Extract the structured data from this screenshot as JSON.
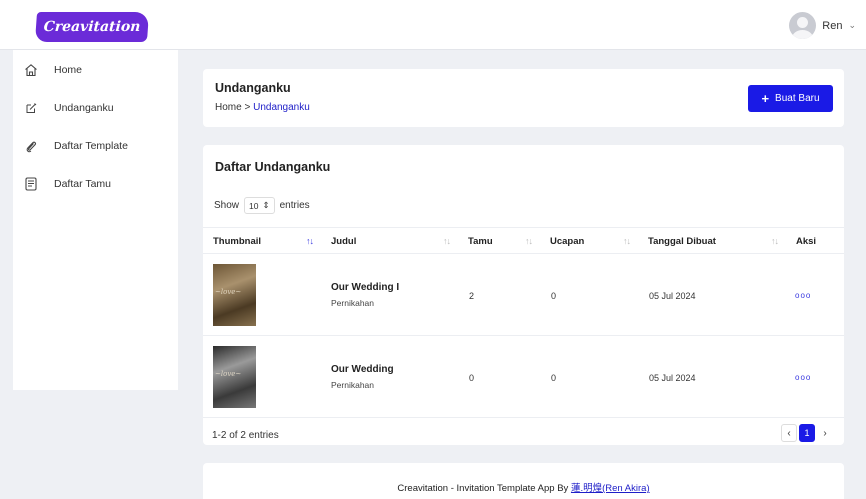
{
  "brand": {
    "logo_text": "Creavitation",
    "accent": "#6b2bd8",
    "primary": "#1a1ae6"
  },
  "user": {
    "name": "Ren",
    "dropdown_icon": "chevron-down-icon"
  },
  "sidebar": {
    "items": [
      {
        "label": "Home",
        "icon": "home-icon"
      },
      {
        "label": "Undanganku",
        "icon": "edit-icon"
      },
      {
        "label": "Daftar Template",
        "icon": "paperclip-icon"
      },
      {
        "label": "Daftar Tamu",
        "icon": "guest-list-icon"
      }
    ]
  },
  "header": {
    "title": "Undanganku",
    "breadcrumb": {
      "home": "Home",
      "separator": ">",
      "current": "Undanganku"
    },
    "new_button": {
      "icon": "+",
      "label": "Buat Baru"
    }
  },
  "table": {
    "title": "Daftar Undanganku",
    "show": {
      "prefix": "Show",
      "value": "10",
      "suffix": "entries"
    },
    "columns": [
      "Thumbnail",
      "Judul",
      "Tamu",
      "Ucapan",
      "Tanggal Dibuat",
      "Aksi"
    ],
    "rows": [
      {
        "title": "Our Wedding I",
        "type": "Pernikahan",
        "tamu": "2",
        "ucapan": "0",
        "date": "05 Jul 2024",
        "action": "ooo"
      },
      {
        "title": "Our Wedding",
        "type": "Pernikahan",
        "tamu": "0",
        "ucapan": "0",
        "date": "05 Jul 2024",
        "action": "ooo"
      }
    ],
    "entries_info": "1-2 of 2 entries",
    "pagination": {
      "prev": "‹",
      "current": "1",
      "next": "›"
    }
  },
  "footer": {
    "text": "Creavitation - Invitation Template App By ",
    "link": "蓮.明煌(Ren Akira)"
  }
}
